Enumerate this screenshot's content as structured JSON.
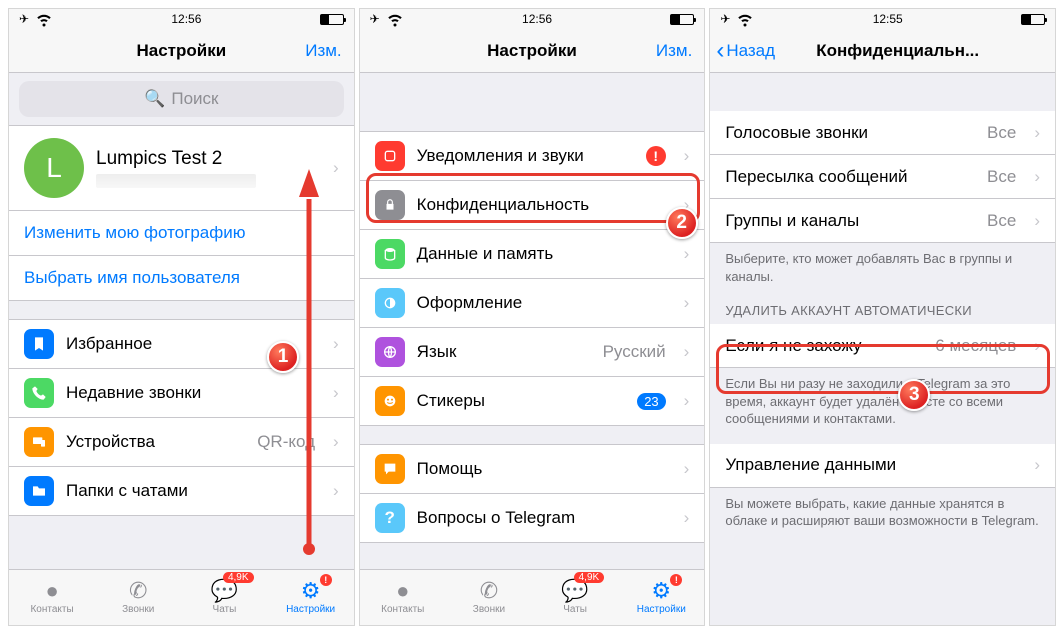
{
  "status": {
    "time1": "12:56",
    "time2": "12:56",
    "time3": "12:55"
  },
  "s1": {
    "title": "Настройки",
    "edit": "Изм.",
    "search_ph": "Поиск",
    "profile_name": "Lumpics Test 2",
    "profile_letter": "L",
    "link_photo": "Изменить мою фотографию",
    "link_username": "Выбрать имя пользователя",
    "fav": "Избранное",
    "recent": "Недавние звонки",
    "devices": "Устройства",
    "devices_val": "QR-код",
    "folders": "Папки с чатами"
  },
  "s2": {
    "title": "Настройки",
    "edit": "Изм.",
    "notif": "Уведомления и звуки",
    "privacy": "Конфиденциальность",
    "data": "Данные и память",
    "appearance": "Оформление",
    "lang": "Язык",
    "lang_val": "Русский",
    "stickers": "Стикеры",
    "stickers_badge": "23",
    "help": "Помощь",
    "faq": "Вопросы о Telegram"
  },
  "s3": {
    "back": "Назад",
    "title": "Конфиденциальн...",
    "voice": "Голосовые звонки",
    "forward": "Пересылка сообщений",
    "groups": "Группы и каналы",
    "all": "Все",
    "groups_footer": "Выберите, кто может добавлять Вас в группы и каналы.",
    "del_header": "УДАЛИТЬ АККАУНТ АВТОМАТИЧЕСКИ",
    "inactive": "Если я не захожу",
    "inactive_val": "6 месяцев",
    "del_footer": "Если Вы ни разу не заходили в Telegram за это время, аккаунт будет удалён вместе со всеми сообщениями и контактами.",
    "data_mgmt": "Управление данными",
    "data_footer": "Вы можете выбрать, какие данные хранятся в облаке и расширяют ваши возможности в Telegram."
  },
  "tabs": {
    "contacts": "Контакты",
    "calls": "Звонки",
    "chats": "Чаты",
    "chats_badge": "4,9K",
    "settings": "Настройки"
  },
  "steps": {
    "one": "1",
    "two": "2",
    "three": "3"
  }
}
